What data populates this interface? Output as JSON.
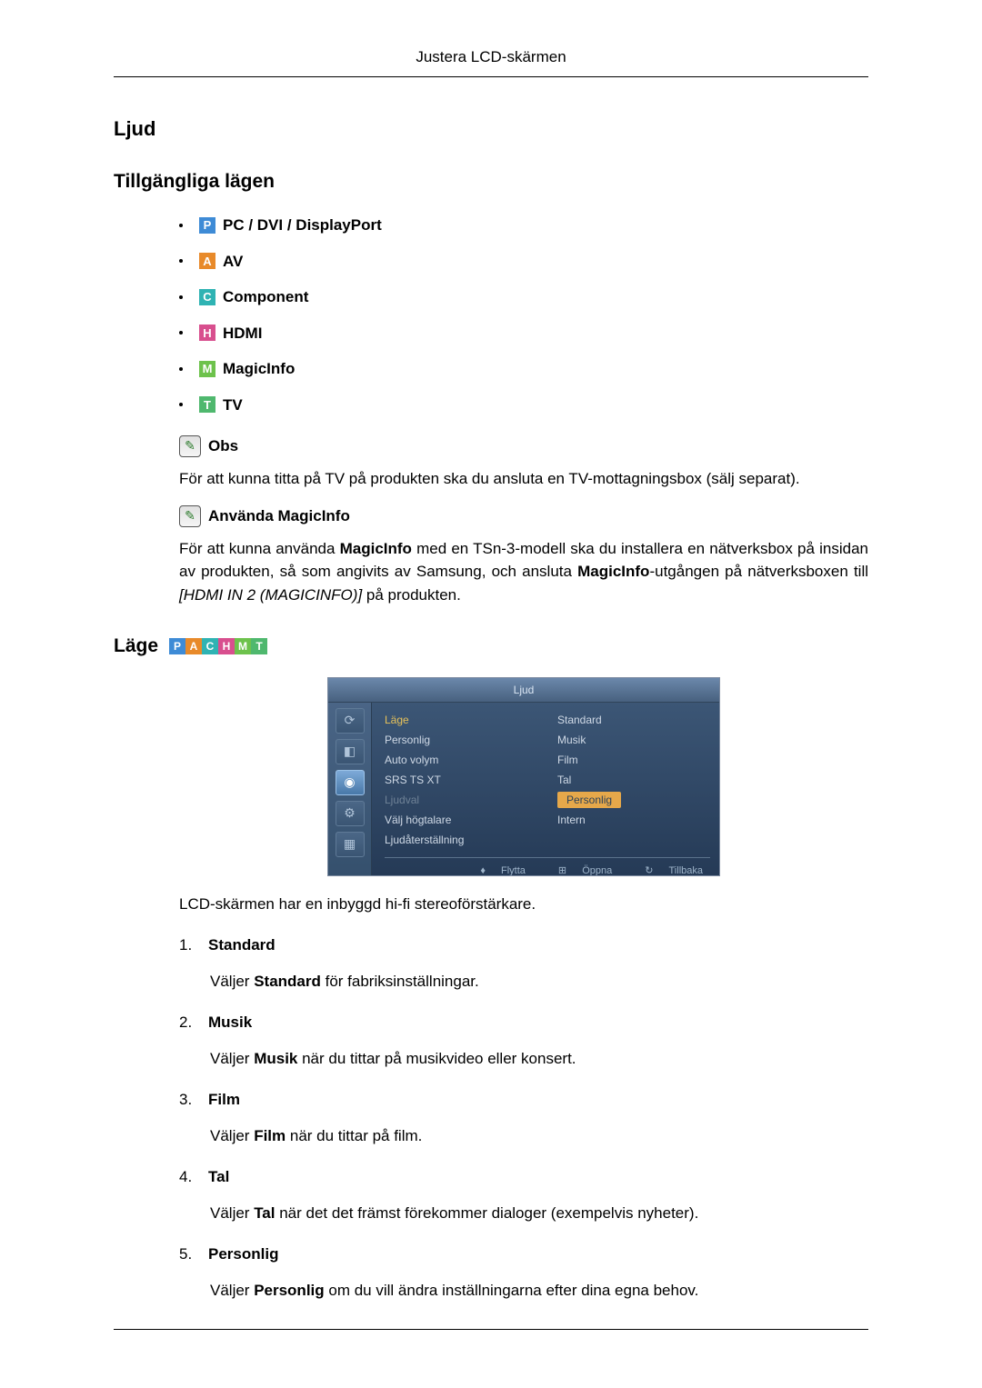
{
  "header": {
    "title": "Justera LCD-skärmen"
  },
  "section": {
    "title": "Ljud"
  },
  "subsection": {
    "title": "Tillgängliga lägen"
  },
  "modes": [
    {
      "icon": "P",
      "label": "PC / DVI / DisplayPort"
    },
    {
      "icon": "A",
      "label": "AV"
    },
    {
      "icon": "C",
      "label": "Component"
    },
    {
      "icon": "H",
      "label": "HDMI"
    },
    {
      "icon": "M",
      "label": "MagicInfo"
    },
    {
      "icon": "T",
      "label": "TV"
    }
  ],
  "notes": {
    "obs_label": "Obs",
    "obs_text": "För att kunna titta på TV på produkten ska du ansluta en TV-mottagningsbox (sälj separat).",
    "magic_label": "Använda MagicInfo",
    "magic_pre": "För att kunna använda ",
    "magic_b1": "MagicInfo",
    "magic_mid": " med en TSn-3-modell ska du installera en nätverksbox på insidan av produkten, så som angivits av Samsung, och ansluta ",
    "magic_b2": "MagicInfo",
    "magic_post": "-utgången på nätverksboxen till ",
    "magic_italic": "[HDMI IN 2 (MAGICINFO)]",
    "magic_tail": " på produkten."
  },
  "lage": {
    "title": "Läge",
    "lead": "LCD-skärmen har en inbyggd hi-fi stereoförstärkare.",
    "items": [
      {
        "label": "Standard",
        "pre": "Väljer ",
        "bold": "Standard",
        "post": " för fabriksinställningar."
      },
      {
        "label": "Musik",
        "pre": "Väljer ",
        "bold": "Musik",
        "post": " när du tittar på musikvideo eller konsert."
      },
      {
        "label": "Film",
        "pre": "Väljer ",
        "bold": "Film",
        "post": " när du tittar på film."
      },
      {
        "label": "Tal",
        "pre": "Väljer ",
        "bold": "Tal",
        "post": " när det det främst förekommer dialoger (exempelvis nyheter)."
      },
      {
        "label": "Personlig",
        "pre": "Väljer ",
        "bold": "Personlig",
        "post": " om du vill ändra inställningarna efter dina egna behov."
      }
    ]
  },
  "osd": {
    "title": "Ljud",
    "rows": [
      {
        "k": "Läge",
        "v": "Standard",
        "state": "hi"
      },
      {
        "k": "Personlig",
        "v": "Musik",
        "state": ""
      },
      {
        "k": "Auto volym",
        "v": "Film",
        "state": ""
      },
      {
        "k": "SRS TS XT",
        "v": "Tal",
        "state": ""
      },
      {
        "k": "Ljudval",
        "v": "Personlig",
        "state": "dim sel"
      },
      {
        "k": "Välj högtalare",
        "v": "Intern",
        "state": ""
      },
      {
        "k": "Ljudåterställning",
        "v": "",
        "state": ""
      }
    ],
    "footer": {
      "move": "Flytta",
      "open": "Öppna",
      "back": "Tillbaka"
    }
  }
}
